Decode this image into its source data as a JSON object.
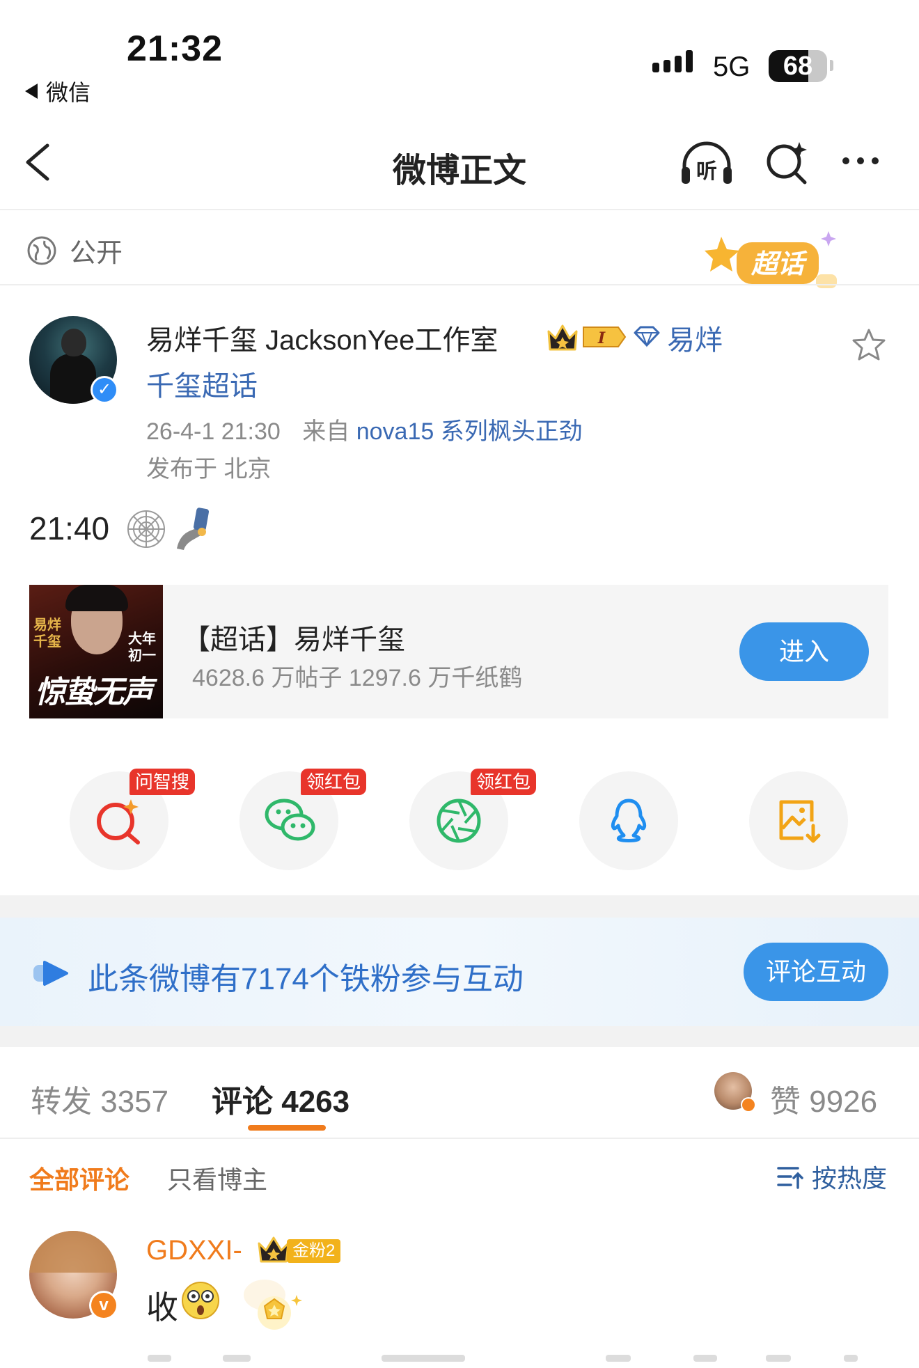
{
  "status_bar": {
    "time": "21:32",
    "back_app": "微信",
    "network": "5G",
    "battery": "68",
    "battery_level": 0.68
  },
  "nav": {
    "title": "微博正文",
    "listen_label": "听"
  },
  "visibility": "公开",
  "supertopic_badge": "超话",
  "author": {
    "name": "易烊千玺 JacksonYee工作室",
    "level_badge": "I",
    "topic_part1": "易烊",
    "topic_part2": "千玺超话",
    "time": "26-4-1 21:30",
    "source_prefix": "来自",
    "source": "nova15 系列枫头正劲",
    "location": "发布于 北京"
  },
  "post": {
    "text": "21:40"
  },
  "topic_card": {
    "title": "【超话】易烊千玺",
    "stats": "4628.6 万帖子 1297.6 万千纸鹤",
    "enter": "进入",
    "cover_left": "易烊\n千玺",
    "cover_right": "大年\n初一",
    "cover_calligraphy": "惊蛰无声"
  },
  "share": {
    "items": [
      {
        "icon": "ai-search-icon",
        "tag": "问智搜",
        "color": "#e8352b"
      },
      {
        "icon": "wechat-icon",
        "tag": "领红包",
        "color": "#2fb86a"
      },
      {
        "icon": "moments-icon",
        "tag": "领红包",
        "color": "#2fb86a"
      },
      {
        "icon": "qq-icon",
        "tag": "",
        "color": "#1f8ef0"
      },
      {
        "icon": "save-image-icon",
        "tag": "",
        "color": "#f2a416"
      }
    ]
  },
  "fans_banner": {
    "text": "此条微博有7174个铁粉参与互动",
    "button": "评论互动"
  },
  "tabs": {
    "repost": "转发 3357",
    "comment": "评论 4263",
    "like": "赞 9926"
  },
  "filters": {
    "all": "全部评论",
    "author_only": "只看博主",
    "sort": "按热度"
  },
  "comment": {
    "user": "GDXXI-",
    "fan_badge": "金粉2",
    "text": "收"
  }
}
